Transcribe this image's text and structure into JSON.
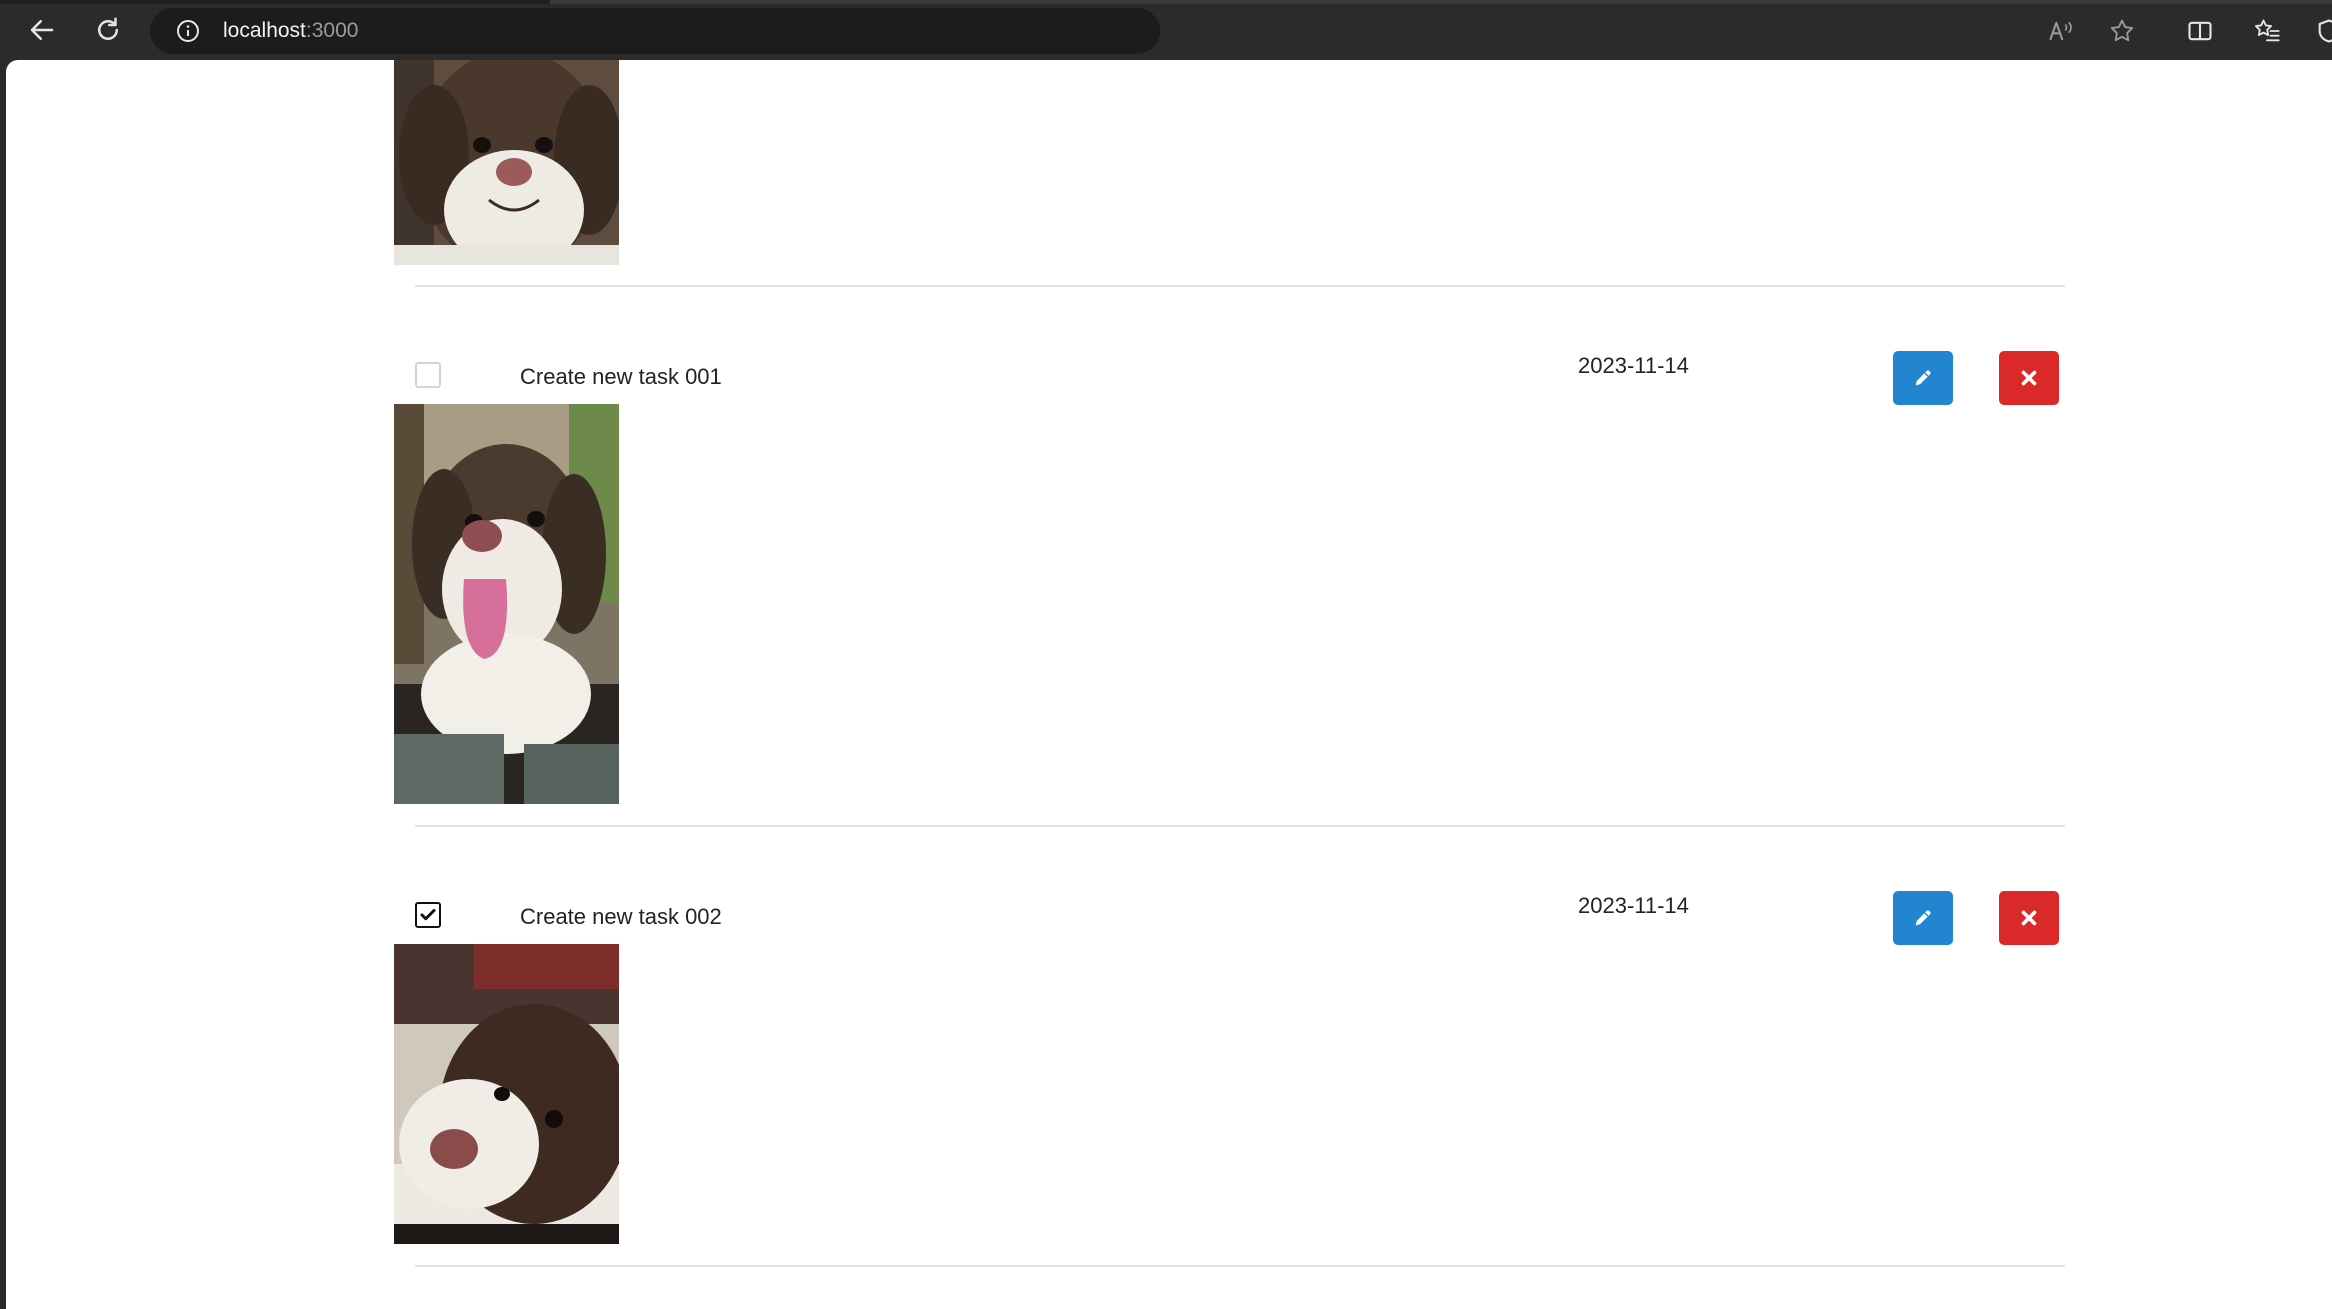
{
  "browser": {
    "url_host": "localhost",
    "url_port": ":3000"
  },
  "tasks": [
    {
      "title": "Create new task 001",
      "date": "2023-11-14",
      "completed": false,
      "image_alt": "puppy-tongue-out"
    },
    {
      "title": "Create new task 002",
      "date": "2023-11-14",
      "completed": true,
      "image_alt": "puppy-resting"
    }
  ],
  "colors": {
    "edit_button": "#2185d0",
    "delete_button": "#db2828",
    "chrome_bg": "#2b2b2b",
    "address_bg": "#1c1c1c",
    "divider": "#e3e3e3"
  },
  "icons": {
    "edit": "pencil-icon",
    "delete": "close-icon",
    "back": "back-arrow-icon",
    "refresh": "refresh-icon",
    "info": "info-icon",
    "read_aloud": "read-aloud-icon",
    "favorite": "star-icon",
    "split_screen": "split-screen-icon",
    "favorites": "favorites-list-icon"
  }
}
